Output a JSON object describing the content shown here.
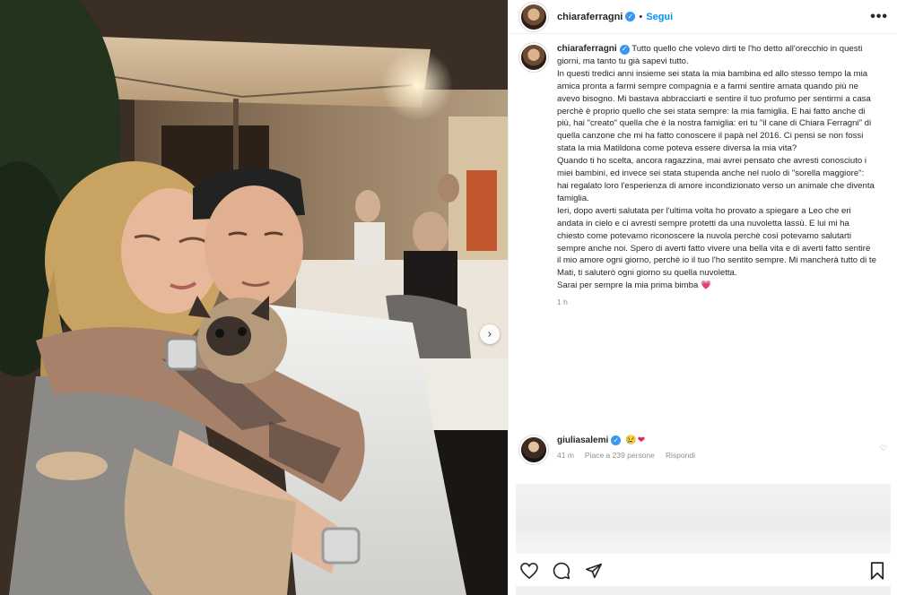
{
  "post": {
    "username": "chiaraferragni",
    "separator": "•",
    "follow_label": "Segui",
    "more_label": "•••"
  },
  "caption": {
    "username": "chiaraferragni",
    "paragraphs": [
      "Tutto quello che volevo dirti te l'ho detto all'orecchio in questi giorni, ma tanto tu già sapevi tutto.",
      "In questi tredici anni insieme sei stata la mia bambina ed allo stesso tempo la mia amica pronta a farmi sempre compagnia e a farmi sentire amata quando più ne avevo bisogno. Mi bastava abbracciarti e sentire il tuo profumo per sentirmi a casa perchè è proprio quello che sei stata sempre: la mia famiglia. E hai fatto anche di più, hai \"creato\" quella che è la nostra famiglia: eri tu \"il cane di Chiara Ferragni\" di quella canzone che mi ha fatto conoscere il papà nel 2016. Ci pensi se non fossi stata la mia Matildona come poteva essere diversa la mia vita?",
      "Quando ti ho scelta, ancora ragazzina, mai avrei pensato che avresti conosciuto i miei bambini, ed invece sei stata stupenda anche nel ruolo di \"sorella maggiore\": hai regalato loro l'esperienza di amore incondizionato verso un animale che diventa famiglia.",
      "Ieri, dopo averti salutata per l'ultima volta ho provato a spiegare a Leo che eri andata in cielo e ci avresti sempre protetti da una nuvoletta lassù. E lui mi ha chiesto come potevamo riconoscere la nuvola perchè così potevamo salutarti sempre anche noi. Spero di averti fatto vivere una bella vita e di averti fatto sentire il mio amore ogni giorno, perchè io il tuo l'ho sentito sempre. Mi mancherà tutto di te Mati, ti saluterò ogni giorno su quella nuvoletta."
    ],
    "closing": "Sarai per sempre la mia prima bimba",
    "closing_emoji": "💗",
    "time": "1 h"
  },
  "comment": {
    "username": "giuliasalemi",
    "emoji_1": "😢",
    "emoji_2": "❤",
    "time": "41 m",
    "likes": "Piace a 239 persone",
    "reply_label": "Rispondi",
    "like_icon": "♡"
  },
  "actions": {
    "like": "heart-icon",
    "comment": "comment-icon",
    "share": "share-icon",
    "save": "bookmark-icon"
  },
  "carousel": {
    "next_glyph": "›"
  },
  "colors": {
    "accent": "#0095f6",
    "verified": "#3897f0",
    "muted": "#8e8e8e"
  }
}
